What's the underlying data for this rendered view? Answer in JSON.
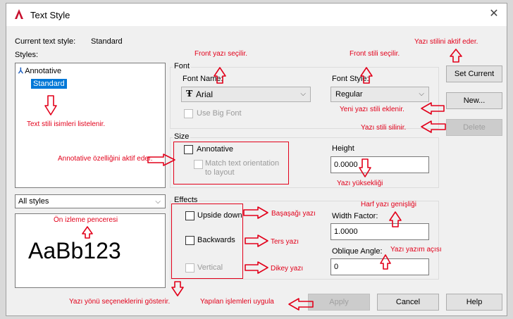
{
  "window": {
    "title": "Text Style",
    "close_glyph": "✕"
  },
  "current_style": {
    "label": "Current text style:",
    "value": "Standard"
  },
  "styles": {
    "label": "Styles:",
    "items": [
      "Annotative",
      "Standard"
    ],
    "selected_index": 1
  },
  "filter": {
    "value": "All styles"
  },
  "preview": {
    "text": "AaBb123"
  },
  "font": {
    "group_label": "Font",
    "name_label": "Font Name:",
    "name_value": "Arial",
    "style_label": "Font Style:",
    "style_value": "Regular",
    "big_font_label": "Use Big Font"
  },
  "size": {
    "group_label": "Size",
    "annotative_label": "Annotative",
    "match_label_line1": "Match text orientation",
    "match_label_line2": "to layout",
    "height_label": "Height",
    "height_value": "0.0000"
  },
  "effects": {
    "group_label": "Effects",
    "upside_down": "Upside down",
    "backwards": "Backwards",
    "vertical": "Vertical",
    "width_label": "Width Factor:",
    "width_value": "1.0000",
    "oblique_label": "Oblique Angle:",
    "oblique_value": "0"
  },
  "buttons": {
    "set_current": "Set Current",
    "new": "New...",
    "delete": "Delete",
    "apply": "Apply",
    "cancel": "Cancel",
    "help": "Help"
  },
  "annotations": {
    "set_current": "Yazı stilini aktif eder.",
    "font_name": "Front yazı seçilir.",
    "font_style": "Front stili seçilir.",
    "new": "Yeni yazı stili eklenir.",
    "delete": "Yazı stili silinir.",
    "styles_list": "Text stili isimleri listelenir.",
    "annotative": "Annotative özelliğini aktif eder.",
    "height": "Yazı yüksekliği",
    "preview": "Ön izleme penceresi",
    "width_factor": "Harf yazı genişliği",
    "upside_down": "Başaşağı yazı",
    "backwards": "Ters yazı",
    "vertical": "Dikey yazı",
    "oblique": "Yazı yazım açısı",
    "direction": "Yazı yönü seçeneklerini gösterir.",
    "apply": "Yapılan işlemleri uygula"
  },
  "colors": {
    "annotation": "#e2001a",
    "selection": "#0078d7",
    "app_icon": "#c8102e"
  }
}
